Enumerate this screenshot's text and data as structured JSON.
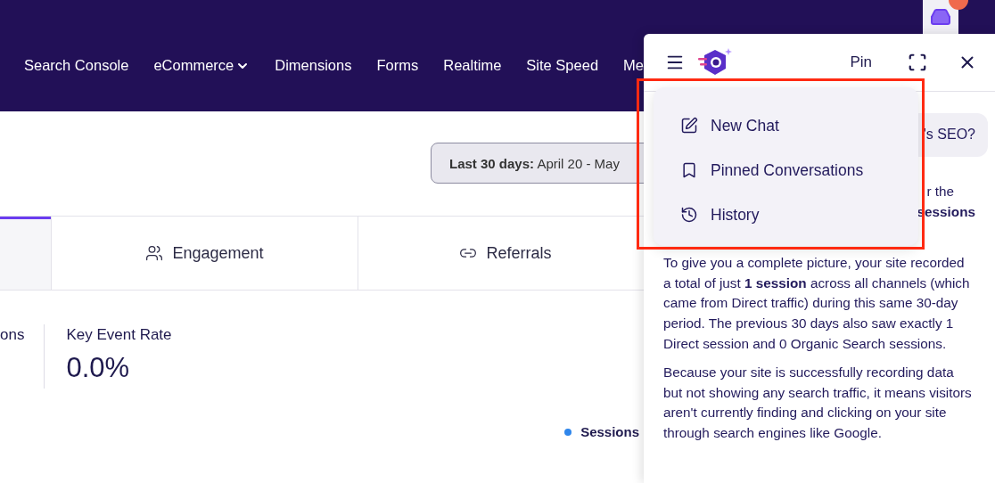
{
  "nav": {
    "items": [
      {
        "label": "Search Console",
        "dropdown": false
      },
      {
        "label": "eCommerce",
        "dropdown": true
      },
      {
        "label": "Dimensions",
        "dropdown": false
      },
      {
        "label": "Forms",
        "dropdown": false
      },
      {
        "label": "Realtime",
        "dropdown": false
      },
      {
        "label": "Site Speed",
        "dropdown": false
      },
      {
        "label": "Me",
        "dropdown": false
      }
    ]
  },
  "date_range": {
    "label": "Last 30 days:",
    "value": "April 20 - May"
  },
  "tabs": [
    {
      "kind": "blank",
      "selected": true
    },
    {
      "kind": "engagement",
      "label": "Engagement",
      "selected": false
    },
    {
      "kind": "referrals",
      "label": "Referrals",
      "selected": false
    }
  ],
  "metrics": [
    {
      "label": "ons"
    },
    {
      "label": "Key Event Rate",
      "value": "0.0%"
    }
  ],
  "legend": [
    {
      "label": "Sessions",
      "color": "#2f86eb"
    }
  ],
  "assistant": {
    "header": {
      "pin": "Pin"
    },
    "menu": [
      {
        "kind": "new",
        "label": "New Chat"
      },
      {
        "kind": "pinned",
        "label": "Pinned Conversations"
      },
      {
        "kind": "history",
        "label": "History"
      }
    ],
    "question_fragment": "'s SEO?",
    "answer_fragments": [
      "r the",
      "**sessions**"
    ],
    "paragraphs": [
      "To give you a complete picture, your site recorded a total of just **1 session** across all channels (which came from Direct traffic) during this same 30-day period. The previous 30 days also saw exactly 1 Direct session and 0 Organic Search sessions.",
      "Because your site is successfully recording data but not showing any search traffic, it means visitors aren't currently finding and clicking on your site through search engines like Google."
    ]
  }
}
